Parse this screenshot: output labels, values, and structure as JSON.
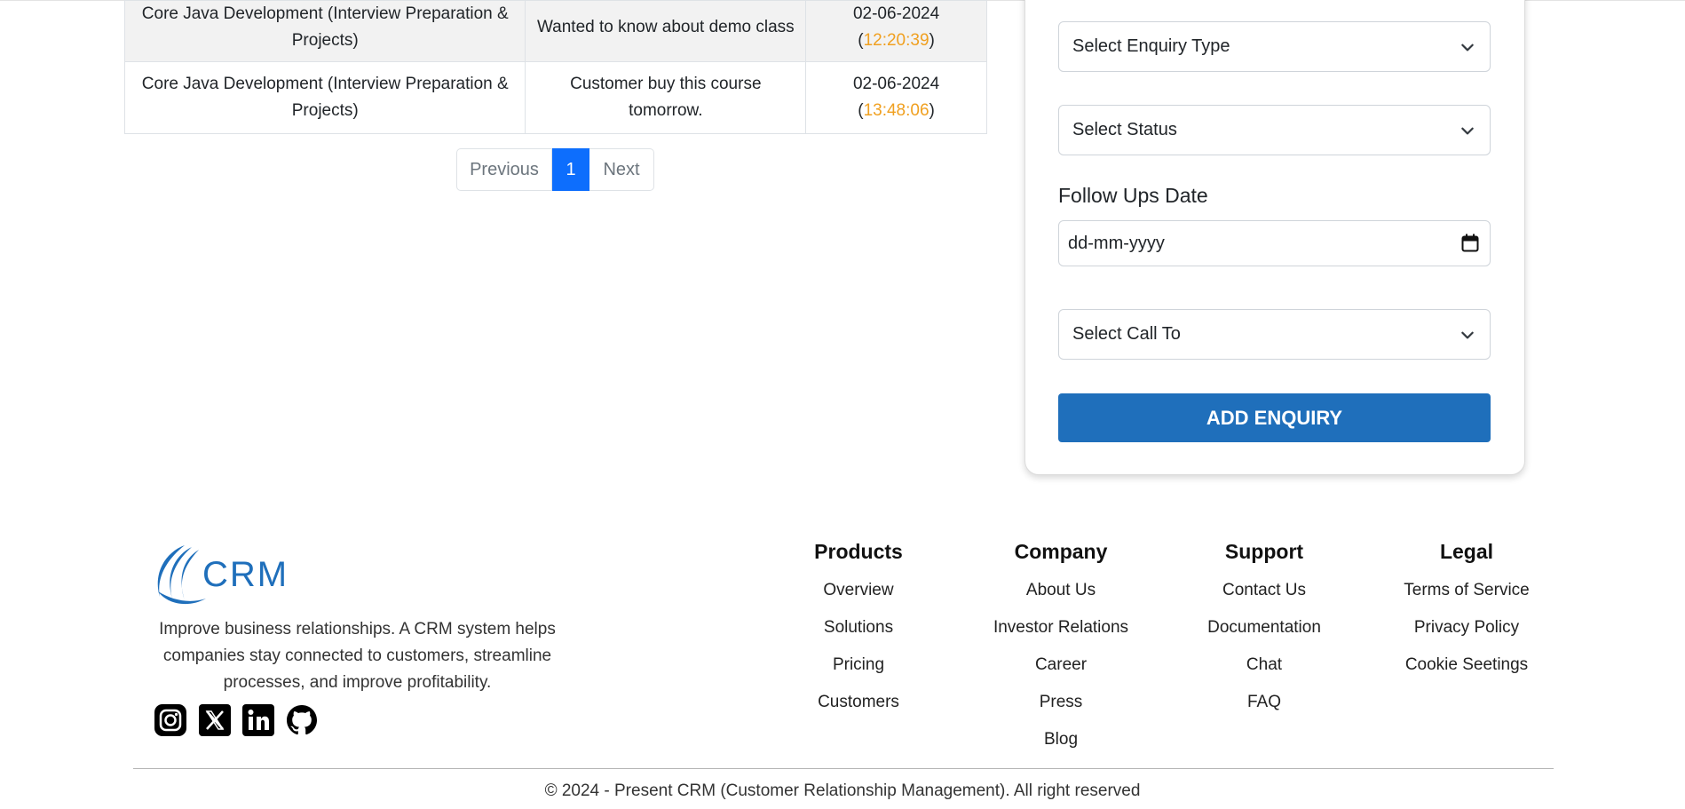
{
  "table": {
    "rows": [
      {
        "course": "Core Java Development (Interview Preparation & Projects)",
        "remark": "Wanted to know about demo class",
        "date": "02-06-2024",
        "time": "12:20:39"
      },
      {
        "course": "Core Java Development (Interview Preparation & Projects)",
        "remark": "Customer buy this course tomorrow.",
        "date": "02-06-2024",
        "time": "13:48:06"
      }
    ]
  },
  "pagination": {
    "previous": "Previous",
    "current": "1",
    "next": "Next"
  },
  "form": {
    "enquiry_type": "Select Enquiry Type",
    "status": "Select Status",
    "follow_ups_label": "Follow Ups Date",
    "follow_ups_placeholder": "dd-mm-yyyy",
    "call_to": "Select Call To",
    "submit": "ADD ENQUIRY"
  },
  "footer": {
    "brand": "CRM",
    "description": "Improve business relationships. A CRM system helps companies stay connected to customers, streamline processes, and improve profitability.",
    "social_icons": [
      "instagram-icon",
      "x-icon",
      "linkedin-icon",
      "github-icon"
    ],
    "columns": [
      {
        "title": "Products",
        "links": [
          "Overview",
          "Solutions",
          "Pricing",
          "Customers"
        ]
      },
      {
        "title": "Company",
        "links": [
          "About Us",
          "Investor Relations",
          "Career",
          "Press",
          "Blog"
        ]
      },
      {
        "title": "Support",
        "links": [
          "Contact Us",
          "Documentation",
          "Chat",
          "FAQ"
        ]
      },
      {
        "title": "Legal",
        "links": [
          "Terms of Service",
          "Privacy Policy",
          "Cookie Seetings"
        ]
      }
    ],
    "copyright": "© 2024 - Present CRM (Customer Relationship Management). All right reserved"
  },
  "colors": {
    "accent": "#1f6fbb",
    "page_active": "#0d6efd",
    "time": "#f0a020"
  }
}
